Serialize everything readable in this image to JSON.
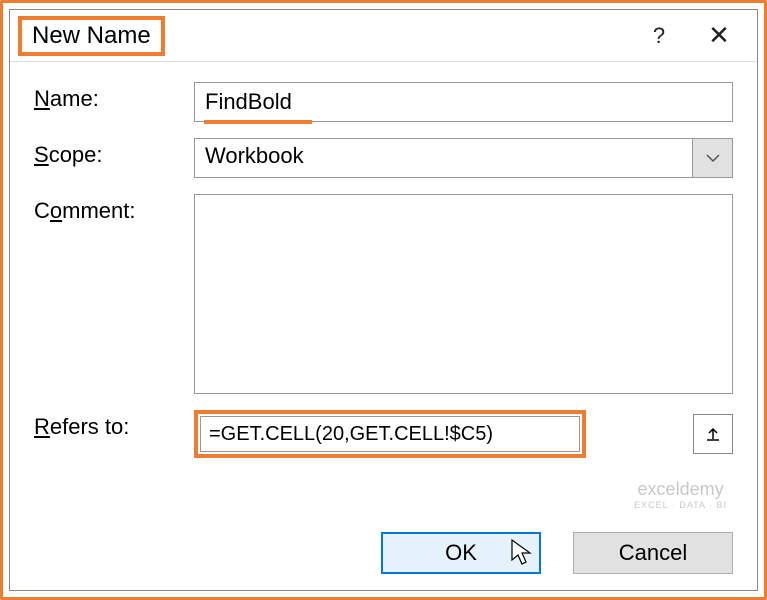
{
  "dialog": {
    "title": "New Name",
    "help_label": "?",
    "close_label": "✕"
  },
  "fields": {
    "name_label": "Name:",
    "name_value": "FindBold",
    "scope_label": "Scope:",
    "scope_value": "Workbook",
    "comment_label": "Comment:",
    "comment_value": "",
    "refers_label": "Refers to:",
    "refers_value": "=GET.CELL(20,GET.CELL!$C5)"
  },
  "buttons": {
    "ok": "OK",
    "cancel": "Cancel"
  },
  "watermark": {
    "main": "exceldemy",
    "sub": "EXCEL · DATA · BI"
  }
}
